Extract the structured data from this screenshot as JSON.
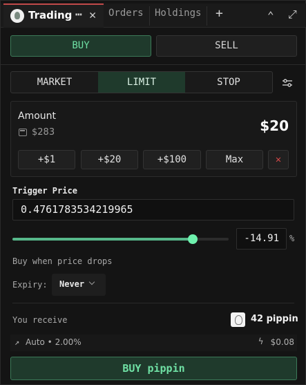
{
  "tabs": {
    "active": {
      "label": "Trading",
      "menu": "⋯",
      "close": "✕"
    },
    "orders": "Orders",
    "holdings": "Holdings",
    "add": "+",
    "collapse": "⌃",
    "expand": "⤢"
  },
  "side": {
    "buy": "BUY",
    "sell": "SELL",
    "selected": "BUY"
  },
  "order_types": {
    "items": [
      "MARKET",
      "LIMIT",
      "STOP"
    ],
    "selected": "LIMIT"
  },
  "amount": {
    "label": "Amount",
    "balance": "$283",
    "value": "$20",
    "quick": [
      "+$1",
      "+$20",
      "+$100",
      "Max"
    ],
    "clear": "✕"
  },
  "trigger": {
    "label": "Trigger Price",
    "value": "0.4761783534219965",
    "percent": "-14.91",
    "percent_sign": "%",
    "slider_level": 0.835,
    "hint": "Buy when price drops"
  },
  "expiry": {
    "label": "Expiry:",
    "value": "Never"
  },
  "receive": {
    "label": "You receive",
    "amount": "42 pippin"
  },
  "meta": {
    "auto_text": "Auto • 2.00%",
    "fee": "$0.08"
  },
  "submit": {
    "label": "BUY pippin"
  },
  "colors": {
    "accent": "#6fe0a4",
    "accent_bg": "#1f3a2c",
    "danger": "#d04848",
    "active_tab_border": "#c24a4a"
  }
}
